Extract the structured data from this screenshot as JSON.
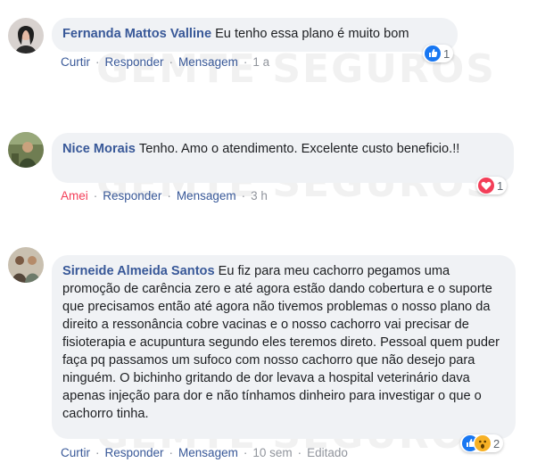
{
  "watermark": "GEMTE SEGUROS",
  "comments": [
    {
      "author": "Fernanda Mattos Valline",
      "text": "Eu tenho essa plano é muito bom",
      "actions": {
        "primary": "Curtir",
        "reply": "Responder",
        "message": "Mensagem",
        "time": "1 a"
      },
      "reaction_count": "1",
      "reactions": [
        "like-icon"
      ]
    },
    {
      "author": "Nice Morais",
      "text": "Tenho. Amo o atendimento. Excelente custo beneficio.!!",
      "actions": {
        "primary": "Amei",
        "reply": "Responder",
        "message": "Mensagem",
        "time": "3 h"
      },
      "reaction_count": "1",
      "reactions": [
        "love-icon"
      ]
    },
    {
      "author": "Sirneide Almeida Santos",
      "text": "Eu fiz para meu cachorro pegamos uma promoção de carência zero e até agora estão dando cobertura e o suporte que precisamos então até agora não tivemos problemas o nosso plano da direito a ressonância cobre vacinas e o nosso cachorro vai precisar de fisioterapia e acupuntura segundo eles teremos direto. Pessoal quem puder faça pq passamos um sufoco com nosso cachorro que não desejo para ninguém. O bichinho gritando de dor levava a hospital veterinário dava apenas injeção para dor e não tínhamos dinheiro para investigar o que o cachorro tinha.",
      "actions": {
        "primary": "Curtir",
        "reply": "Responder",
        "message": "Mensagem",
        "time": "10 sem",
        "edited": "Editado"
      },
      "reaction_count": "2",
      "reactions": [
        "like-icon",
        "wow-icon"
      ]
    }
  ],
  "colors": {
    "link": "#385898",
    "love": "#f33e58",
    "like": "#1877f2",
    "bubble": "#f0f2f5",
    "meta": "#90949c"
  }
}
